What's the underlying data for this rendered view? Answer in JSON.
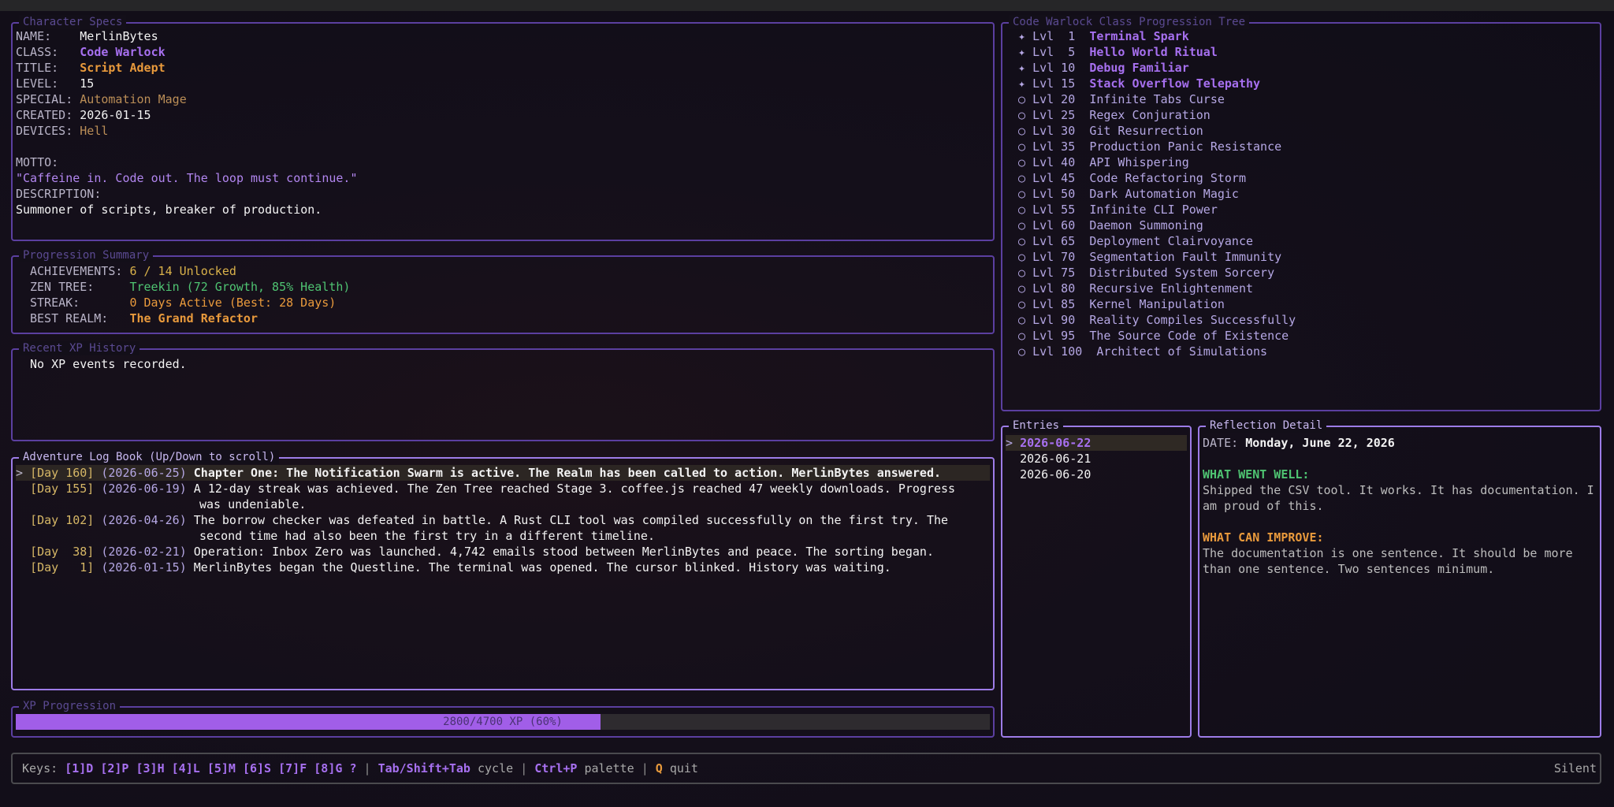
{
  "character": {
    "title": "Character Specs",
    "fields": [
      {
        "label": "NAME:    ",
        "value": "MerlinBytes",
        "style": "white"
      },
      {
        "label": "CLASS:   ",
        "value": "Code Warlock",
        "style": "purple"
      },
      {
        "label": "TITLE:   ",
        "value": "Script Adept",
        "style": "orange"
      },
      {
        "label": "LEVEL:   ",
        "value": "15",
        "style": "white"
      },
      {
        "label": "SPECIAL: ",
        "value": "Automation Mage",
        "style": "tan"
      },
      {
        "label": "CREATED: ",
        "value": "2026-01-15",
        "style": "white"
      },
      {
        "label": "DEVICES: ",
        "value": "Hell",
        "style": "tan"
      }
    ],
    "motto_label": "MOTTO:",
    "motto": "\"Caffeine in. Code out. The loop must continue.\"",
    "description_label": "DESCRIPTION:",
    "description": "Summoner of scripts, breaker of production."
  },
  "summary": {
    "title": "Progression Summary",
    "rows": [
      {
        "label": "ACHIEVEMENTS: ",
        "value": "6 / 14 Unlocked",
        "style": "gold"
      },
      {
        "label": "ZEN TREE:     ",
        "value": "Treekin (72 Growth, 85% Health)",
        "style": "green"
      },
      {
        "label": "STREAK:       ",
        "value": "0 Days Active (Best: 28 Days)",
        "style": "orange-n"
      },
      {
        "label": "BEST REALM:   ",
        "value": "The Grand Refactor",
        "style": "orange"
      }
    ]
  },
  "xp_history": {
    "title": "Recent XP History",
    "empty": "No XP events recorded."
  },
  "log": {
    "title": "Adventure Log Book (Up/Down to scroll)",
    "entries": [
      {
        "marker": ">",
        "day": "[Day 160]",
        "date": "(2026-06-25)",
        "lines": [
          "Chapter One: The Notification Swarm is active. The Realm has been called to action. MerlinBytes answered."
        ],
        "selected": true
      },
      {
        "marker": " ",
        "day": "[Day 155]",
        "date": "(2026-06-19)",
        "lines": [
          "A 12-day streak was achieved. The Zen Tree reached Stage 3. coffee.js reached 47 weekly downloads. Progress",
          "was undeniable."
        ],
        "selected": false
      },
      {
        "marker": " ",
        "day": "[Day 102]",
        "date": "(2026-04-26)",
        "lines": [
          "The borrow checker was defeated in battle. A Rust CLI tool was compiled successfully on the first try. The",
          "second time had also been the first try in a different timeline."
        ],
        "selected": false
      },
      {
        "marker": " ",
        "day": "[Day  38]",
        "date": "(2026-02-21)",
        "lines": [
          "Operation: Inbox Zero was launched. 4,742 emails stood between MerlinBytes and peace. The sorting began."
        ],
        "selected": false
      },
      {
        "marker": " ",
        "day": "[Day   1]",
        "date": "(2026-01-15)",
        "lines": [
          "MerlinBytes began the Questline. The terminal was opened. The cursor blinked. History was waiting."
        ],
        "selected": false
      }
    ]
  },
  "xp_progress": {
    "title": "XP Progression",
    "text": "2800/4700 XP (60%)",
    "fraction": 0.6,
    "fill_color": "#a15ee8"
  },
  "tree": {
    "title": "Code Warlock Class Progression Tree",
    "nodes": [
      {
        "icon": "✦",
        "level": "Lvl  1 ",
        "name": "Terminal Spark",
        "unlocked": true
      },
      {
        "icon": "✦",
        "level": "Lvl  5 ",
        "name": "Hello World Ritual",
        "unlocked": true
      },
      {
        "icon": "✦",
        "level": "Lvl 10 ",
        "name": "Debug Familiar",
        "unlocked": true
      },
      {
        "icon": "✦",
        "level": "Lvl 15 ",
        "name": "Stack Overflow Telepathy",
        "unlocked": true
      },
      {
        "icon": "○",
        "level": "Lvl 20 ",
        "name": "Infinite Tabs Curse",
        "unlocked": false
      },
      {
        "icon": "○",
        "level": "Lvl 25 ",
        "name": "Regex Conjuration",
        "unlocked": false
      },
      {
        "icon": "○",
        "level": "Lvl 30 ",
        "name": "Git Resurrection",
        "unlocked": false
      },
      {
        "icon": "○",
        "level": "Lvl 35 ",
        "name": "Production Panic Resistance",
        "unlocked": false
      },
      {
        "icon": "○",
        "level": "Lvl 40 ",
        "name": "API Whispering",
        "unlocked": false
      },
      {
        "icon": "○",
        "level": "Lvl 45 ",
        "name": "Code Refactoring Storm",
        "unlocked": false
      },
      {
        "icon": "○",
        "level": "Lvl 50 ",
        "name": "Dark Automation Magic",
        "unlocked": false
      },
      {
        "icon": "○",
        "level": "Lvl 55 ",
        "name": "Infinite CLI Power",
        "unlocked": false
      },
      {
        "icon": "○",
        "level": "Lvl 60 ",
        "name": "Daemon Summoning",
        "unlocked": false
      },
      {
        "icon": "○",
        "level": "Lvl 65 ",
        "name": "Deployment Clairvoyance",
        "unlocked": false
      },
      {
        "icon": "○",
        "level": "Lvl 70 ",
        "name": "Segmentation Fault Immunity",
        "unlocked": false
      },
      {
        "icon": "○",
        "level": "Lvl 75 ",
        "name": "Distributed System Sorcery",
        "unlocked": false
      },
      {
        "icon": "○",
        "level": "Lvl 80 ",
        "name": "Recursive Enlightenment",
        "unlocked": false
      },
      {
        "icon": "○",
        "level": "Lvl 85 ",
        "name": "Kernel Manipulation",
        "unlocked": false
      },
      {
        "icon": "○",
        "level": "Lvl 90 ",
        "name": "Reality Compiles Successfully",
        "unlocked": false
      },
      {
        "icon": "○",
        "level": "Lvl 95 ",
        "name": "The Source Code of Existence",
        "unlocked": false
      },
      {
        "icon": "○",
        "level": "Lvl 100 ",
        "name": "Architect of Simulations",
        "unlocked": false
      }
    ]
  },
  "entries": {
    "title": "Entries",
    "items": [
      {
        "marker": ">",
        "date": "2026-06-22",
        "selected": true
      },
      {
        "marker": " ",
        "date": "2026-06-21",
        "selected": false
      },
      {
        "marker": " ",
        "date": "2026-06-20",
        "selected": false
      }
    ]
  },
  "reflection": {
    "title": "Reflection Detail",
    "date_label": "DATE: ",
    "date": "Monday, June 22, 2026",
    "well_label": "WHAT WENT WELL:",
    "well_lines": [
      "Shipped the CSV tool. It works. It has documentation. I",
      "am proud of this."
    ],
    "improve_label": "WHAT CAN IMPROVE:",
    "improve_lines": [
      "The documentation is one sentence. It should be more",
      "than one sentence. Two sentences minimum."
    ]
  },
  "keybar": {
    "keys_label": "Keys: ",
    "tabs": [
      "[1]D",
      "[2]P",
      "[3]H",
      "[4]L",
      "[5]M",
      "[6]S",
      "[7]F",
      "[8]G",
      "?"
    ],
    "cycle_key": "Tab/Shift+Tab",
    "cycle_text": " cycle ",
    "palette_key": "Ctrl+P",
    "palette_text": " palette ",
    "quit_key": "Q",
    "quit_text": " quit",
    "sep": "|",
    "status": "Silent"
  }
}
